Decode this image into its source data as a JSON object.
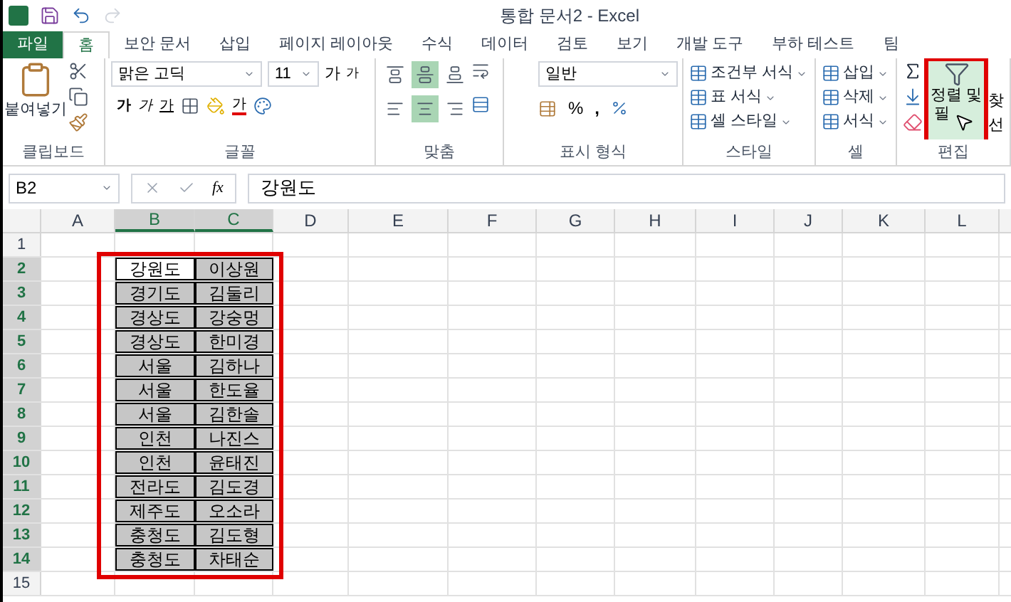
{
  "window": {
    "title": "통합 문서2 - Excel"
  },
  "tabs": [
    {
      "label": "파일",
      "kind": "file",
      "selected": false
    },
    {
      "label": "홈",
      "kind": "tab",
      "selected": true
    },
    {
      "label": "보안 문서",
      "kind": "tab",
      "selected": false
    },
    {
      "label": "삽입",
      "kind": "tab",
      "selected": false
    },
    {
      "label": "페이지 레이아웃",
      "kind": "tab",
      "selected": false
    },
    {
      "label": "수식",
      "kind": "tab",
      "selected": false
    },
    {
      "label": "데이터",
      "kind": "tab",
      "selected": false
    },
    {
      "label": "검토",
      "kind": "tab",
      "selected": false
    },
    {
      "label": "보기",
      "kind": "tab",
      "selected": false
    },
    {
      "label": "개발 도구",
      "kind": "tab",
      "selected": false
    },
    {
      "label": "부하 테스트",
      "kind": "tab",
      "selected": false
    },
    {
      "label": "팀",
      "kind": "tab",
      "selected": false
    }
  ],
  "ribbon": {
    "clipboard": {
      "label": "클립보드",
      "paste": "붙여넣기"
    },
    "font": {
      "label": "글꼴",
      "font_name": "맑은 고딕",
      "font_size": "11",
      "grow": "가",
      "shrink": "가",
      "bold": "가",
      "italic": "가",
      "underline": "가",
      "font_color": "가"
    },
    "alignment": {
      "label": "맞춤",
      "vertical": [
        {
          "selected": false
        },
        {
          "selected": true
        },
        {
          "selected": false
        }
      ],
      "horizontal": [
        {
          "selected": false
        },
        {
          "selected": true
        },
        {
          "selected": false
        }
      ]
    },
    "number": {
      "label": "표시 형식",
      "format": "일반",
      "percent": "%",
      "comma": ","
    },
    "styles": {
      "label": "스타일",
      "items": [
        "조건부 서식",
        "표 서식",
        "셀 스타일"
      ]
    },
    "cells": {
      "label": "셀",
      "items": [
        "삽입",
        "삭제",
        "서식"
      ]
    },
    "editing": {
      "label": "편집",
      "sort_filter": {
        "line1": "정렬 및",
        "line2": "필",
        "highlighted": true
      },
      "find": [
        "찾",
        "선"
      ]
    }
  },
  "formula_bar": {
    "name_box": "B2",
    "function_label": "fx",
    "value": "강원도"
  },
  "sheet": {
    "columns": [
      {
        "label": "A",
        "selected": false
      },
      {
        "label": "B",
        "selected": true
      },
      {
        "label": "C",
        "selected": true
      },
      {
        "label": "D",
        "selected": false
      },
      {
        "label": "E",
        "selected": false
      },
      {
        "label": "F",
        "selected": false
      },
      {
        "label": "G",
        "selected": false
      },
      {
        "label": "H",
        "selected": false
      },
      {
        "label": "I",
        "selected": false
      },
      {
        "label": "J",
        "selected": false
      },
      {
        "label": "K",
        "selected": false
      },
      {
        "label": "L",
        "selected": false
      }
    ],
    "range_highlighted": true,
    "rows": [
      {
        "number": "1",
        "selected": false
      },
      {
        "number": "2",
        "selected": true,
        "cells": [
          {
            "text": "강원도",
            "active": true
          },
          {
            "text": "이상원",
            "active": false
          }
        ]
      },
      {
        "number": "3",
        "selected": true,
        "cells": [
          {
            "text": "경기도",
            "active": false
          },
          {
            "text": "김둘리",
            "active": false
          }
        ]
      },
      {
        "number": "4",
        "selected": true,
        "cells": [
          {
            "text": "경상도",
            "active": false
          },
          {
            "text": "강숭멍",
            "active": false
          }
        ]
      },
      {
        "number": "5",
        "selected": true,
        "cells": [
          {
            "text": "경상도",
            "active": false
          },
          {
            "text": "한미경",
            "active": false
          }
        ]
      },
      {
        "number": "6",
        "selected": true,
        "cells": [
          {
            "text": "서울",
            "active": false
          },
          {
            "text": "김하나",
            "active": false
          }
        ]
      },
      {
        "number": "7",
        "selected": true,
        "cells": [
          {
            "text": "서울",
            "active": false
          },
          {
            "text": "한도율",
            "active": false
          }
        ]
      },
      {
        "number": "8",
        "selected": true,
        "cells": [
          {
            "text": "서울",
            "active": false
          },
          {
            "text": "김한솔",
            "active": false
          }
        ]
      },
      {
        "number": "9",
        "selected": true,
        "cells": [
          {
            "text": "인천",
            "active": false
          },
          {
            "text": "나진스",
            "active": false
          }
        ]
      },
      {
        "number": "10",
        "selected": true,
        "cells": [
          {
            "text": "인천",
            "active": false
          },
          {
            "text": "윤태진",
            "active": false
          }
        ]
      },
      {
        "number": "11",
        "selected": true,
        "cells": [
          {
            "text": "전라도",
            "active": false
          },
          {
            "text": "김도경",
            "active": false
          }
        ]
      },
      {
        "number": "12",
        "selected": true,
        "cells": [
          {
            "text": "제주도",
            "active": false
          },
          {
            "text": "오소라",
            "active": false
          }
        ]
      },
      {
        "number": "13",
        "selected": true,
        "cells": [
          {
            "text": "충청도",
            "active": false
          },
          {
            "text": "김도형",
            "active": false
          }
        ]
      },
      {
        "number": "14",
        "selected": true,
        "cells": [
          {
            "text": "충청도",
            "active": false
          },
          {
            "text": "차태순",
            "active": false
          }
        ]
      },
      {
        "number": "15",
        "selected": false
      }
    ]
  }
}
